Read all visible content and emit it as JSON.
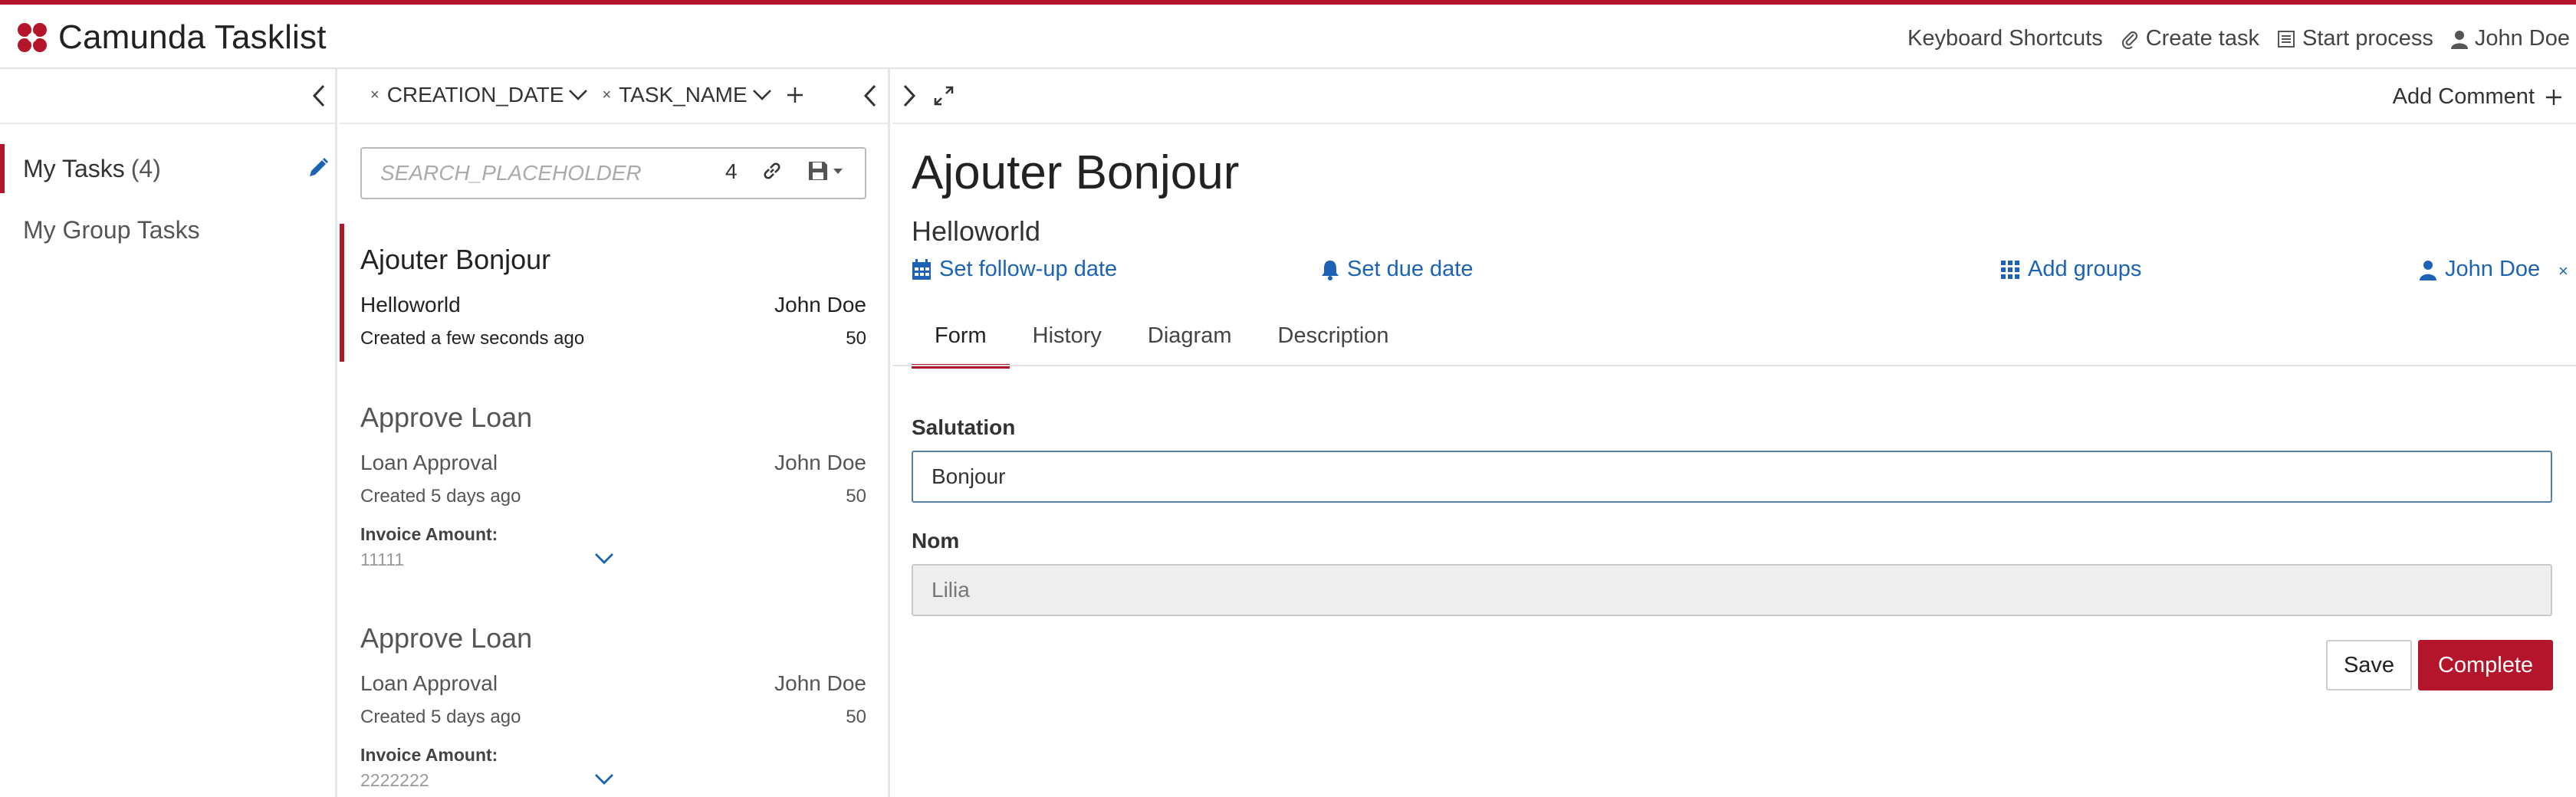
{
  "header": {
    "title": "Camunda Tasklist",
    "nav": {
      "shortcuts": "Keyboard Shortcuts",
      "create_task": "Create task",
      "start_process": "Start process",
      "user": "John Doe"
    }
  },
  "filters": {
    "items": [
      {
        "label": "My Tasks",
        "count": "(4)"
      },
      {
        "label": "My Group Tasks"
      }
    ]
  },
  "list": {
    "sorting": [
      "CREATION_DATE",
      "TASK_NAME"
    ],
    "search": {
      "placeholder": "SEARCH_PLACEHOLDER",
      "count": "4"
    },
    "tasks": [
      {
        "name": "Ajouter Bonjour",
        "process": "Helloworld",
        "assignee": "John Doe",
        "created": "Created a few seconds ago",
        "priority": "50"
      },
      {
        "name": "Approve Loan",
        "process": "Loan Approval",
        "assignee": "John Doe",
        "created": "Created 5 days ago",
        "priority": "50",
        "var_label": "Invoice Amount:",
        "var_value": "11111"
      },
      {
        "name": "Approve Loan",
        "process": "Loan Approval",
        "assignee": "John Doe",
        "created": "Created 5 days ago",
        "priority": "50",
        "var_label": "Invoice Amount:",
        "var_value": "2222222"
      }
    ]
  },
  "task": {
    "add_comment": "Add Comment",
    "name": "Ajouter Bonjour",
    "process": "Helloworld",
    "actions": {
      "follow_up": "Set follow-up date",
      "due": "Set due date",
      "groups": "Add groups",
      "assignee": "John Doe"
    },
    "tabs": [
      "Form",
      "History",
      "Diagram",
      "Description"
    ],
    "form": {
      "salutation_label": "Salutation",
      "salutation_value": "Bonjour",
      "nom_label": "Nom",
      "nom_value": "Lilia",
      "save": "Save",
      "complete": "Complete"
    }
  },
  "colors": {
    "accent": "#b5152b",
    "link": "#1d63b5"
  }
}
